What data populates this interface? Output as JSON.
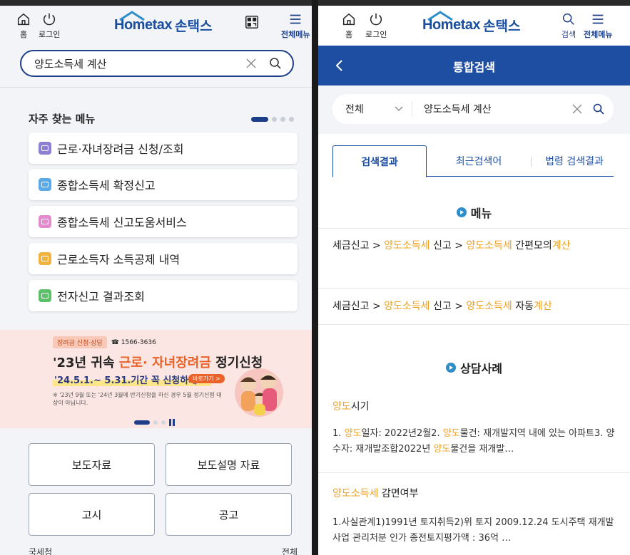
{
  "left": {
    "header": {
      "home_label": "홈",
      "logout_label": "로그인",
      "logo_text": "Hometax",
      "logo_kr": "손택스",
      "qr_label": "",
      "menu_label": "전체메뉴"
    },
    "search": {
      "value": "양도소득세 계산"
    },
    "frequent": {
      "title": "자주 찾는 메뉴",
      "items": [
        {
          "label": "근로·자녀장려금 신청/조회",
          "color": "#8b7fd6"
        },
        {
          "label": "종합소득세 확정신고",
          "color": "#5aa9e8"
        },
        {
          "label": "종합소득세 신고도움서비스",
          "color": "#e48ad0"
        },
        {
          "label": "근로소득자 소득공제 내역",
          "color": "#f2b240"
        },
        {
          "label": "전자신고 결과조회",
          "color": "#5cbf6a"
        }
      ]
    },
    "banner": {
      "tag": "장려금 신청·상담",
      "phone": "☎ 1566-3636",
      "title_pre": "'23년 귀속 ",
      "title_hl": "근로· 자녀장려금",
      "title_post": " 정기신청",
      "period": "'24.5.1.~ 5.31.기간 꼭 신청하세요!",
      "go": "바로가기 >",
      "note": "※ '23년 9월 또는 '24년 3월에 반기신청을 하신 경우 5월 정기신청 대상이 아닙니다."
    },
    "buttons": [
      "보도자료",
      "보도설명 자료",
      "고시",
      "공고"
    ],
    "bottom_left": "국세청",
    "bottom_right": "전체"
  },
  "right": {
    "header": {
      "home_label": "홈",
      "logout_label": "로그인",
      "search_label": "검색",
      "menu_label": "전체메뉴"
    },
    "nav": {
      "title": "통합검색"
    },
    "search": {
      "scope": "전체",
      "value": "양도소득세 계산"
    },
    "tabs": [
      "검색결과",
      "최근검색어",
      "법령 검색결과"
    ],
    "menu_section": {
      "title": "메뉴",
      "rows": [
        [
          {
            "t": "세금신고 > "
          },
          {
            "t": "양도소득세",
            "hl": true
          },
          {
            "t": " 신고 > "
          },
          {
            "t": "양도소득세",
            "hl": true
          },
          {
            "t": " 간편모의"
          },
          {
            "t": "계산",
            "hl": true
          }
        ],
        [
          {
            "t": "세금신고 > "
          },
          {
            "t": "양도소득세",
            "hl": true
          },
          {
            "t": " 신고 > "
          },
          {
            "t": "양도소득세",
            "hl": true
          },
          {
            "t": " 자동"
          },
          {
            "t": "계산",
            "hl": true
          }
        ]
      ]
    },
    "case_section": {
      "title": "상담사례",
      "cases": [
        {
          "title": [
            {
              "t": "양도",
              "hl": true
            },
            {
              "t": "시기"
            }
          ],
          "body": [
            {
              "t": "1. "
            },
            {
              "t": "양도",
              "hl": true
            },
            {
              "t": "일자: 2022년2월2. "
            },
            {
              "t": "양도",
              "hl": true
            },
            {
              "t": "물건: 재개발지역 내에 있는 아파트3. 양수자: 재개발조합2022년 "
            },
            {
              "t": "양도",
              "hl": true
            },
            {
              "t": "물건을 재개발…"
            }
          ]
        },
        {
          "title": [
            {
              "t": "양도소득세",
              "hl": true
            },
            {
              "t": " 감면여부"
            }
          ],
          "body": [
            {
              "t": "1.사실관계1)1991년 토지취득2)위 토지 2009.12.24 도시주택 재개발사업 관리처분 인가 종전토지평가액 : 36억 …"
            }
          ]
        }
      ]
    }
  },
  "colors": {
    "brand_blue": "#1d4ea2",
    "highlight": "#f0a020",
    "banner_bg": "#fbe6e3"
  }
}
